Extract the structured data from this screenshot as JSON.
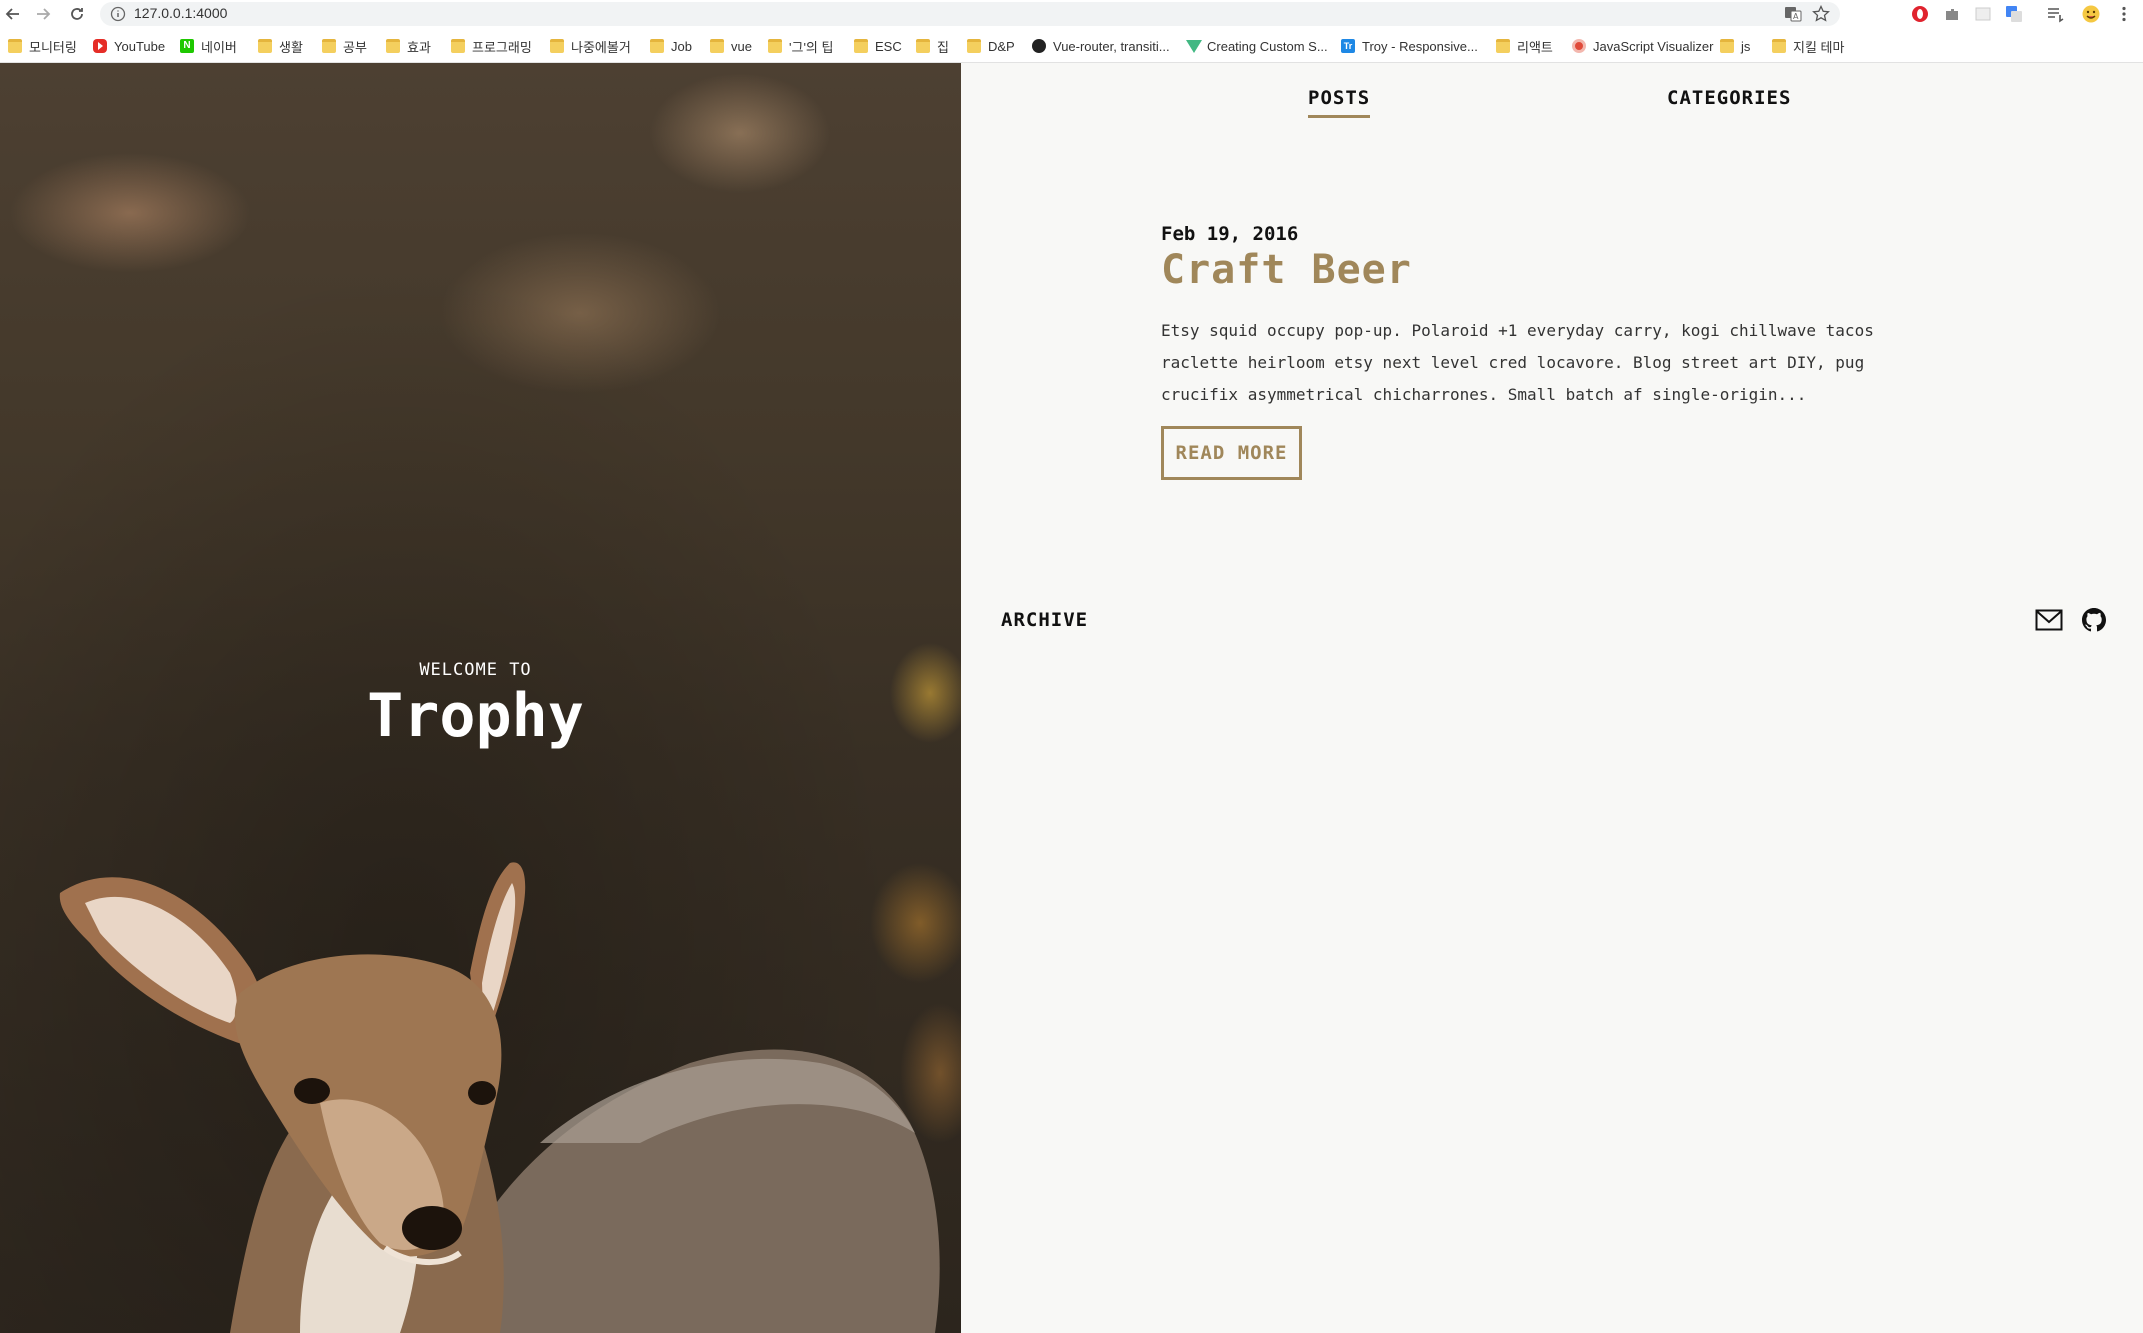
{
  "browser": {
    "url": "127.0.0.1:4000"
  },
  "bookmarks": [
    {
      "label": "모니터링",
      "icon": "folder-icon"
    },
    {
      "label": "YouTube",
      "icon": "youtube-icon"
    },
    {
      "label": "네이버",
      "icon": "naver-icon"
    },
    {
      "label": "생활",
      "icon": "folder-icon"
    },
    {
      "label": "공부",
      "icon": "folder-icon"
    },
    {
      "label": "효과",
      "icon": "folder-icon"
    },
    {
      "label": "프로그래밍",
      "icon": "folder-icon"
    },
    {
      "label": "나중에볼거",
      "icon": "folder-icon"
    },
    {
      "label": "Job",
      "icon": "folder-icon"
    },
    {
      "label": "vue",
      "icon": "folder-icon"
    },
    {
      "label": "'그'의 팁",
      "icon": "folder-icon"
    },
    {
      "label": "ESC",
      "icon": "folder-icon"
    },
    {
      "label": "집",
      "icon": "folder-icon"
    },
    {
      "label": "D&P",
      "icon": "folder-icon"
    },
    {
      "label": "Vue-router, transiti...",
      "icon": "github-icon"
    },
    {
      "label": "Creating Custom S...",
      "icon": "vue-icon"
    },
    {
      "label": "Troy - Responsive...",
      "icon": "trello-icon"
    },
    {
      "label": "리액트",
      "icon": "folder-icon"
    },
    {
      "label": "JavaScript Visualizer",
      "icon": "js-visualizer-icon"
    },
    {
      "label": "js",
      "icon": "folder-icon"
    },
    {
      "label": "지킬 테마",
      "icon": "folder-icon"
    }
  ],
  "bookmark_icon_text": {
    "naver": "N",
    "trello": "Tr"
  },
  "hero": {
    "welcome": "WELCOME TO",
    "title": "Trophy"
  },
  "nav": {
    "posts": "POSTS",
    "categories": "CATEGORIES"
  },
  "post": {
    "date": "Feb 19, 2016",
    "title": "Craft Beer",
    "excerpt": "Etsy squid occupy pop-up. Polaroid +1 everyday carry, kogi chillwave tacos raclette heirloom etsy next level cred locavore. Blog street art DIY, pug crucifix asymmetrical chicharrones. Small batch af single-origin...",
    "read_more": "READ MORE"
  },
  "footer": {
    "archive": "ARCHIVE",
    "icons": [
      "mail-icon",
      "github-icon"
    ]
  },
  "colors": {
    "accent": "#a0875a",
    "background": "#f8f8f6",
    "text": "#111111"
  }
}
